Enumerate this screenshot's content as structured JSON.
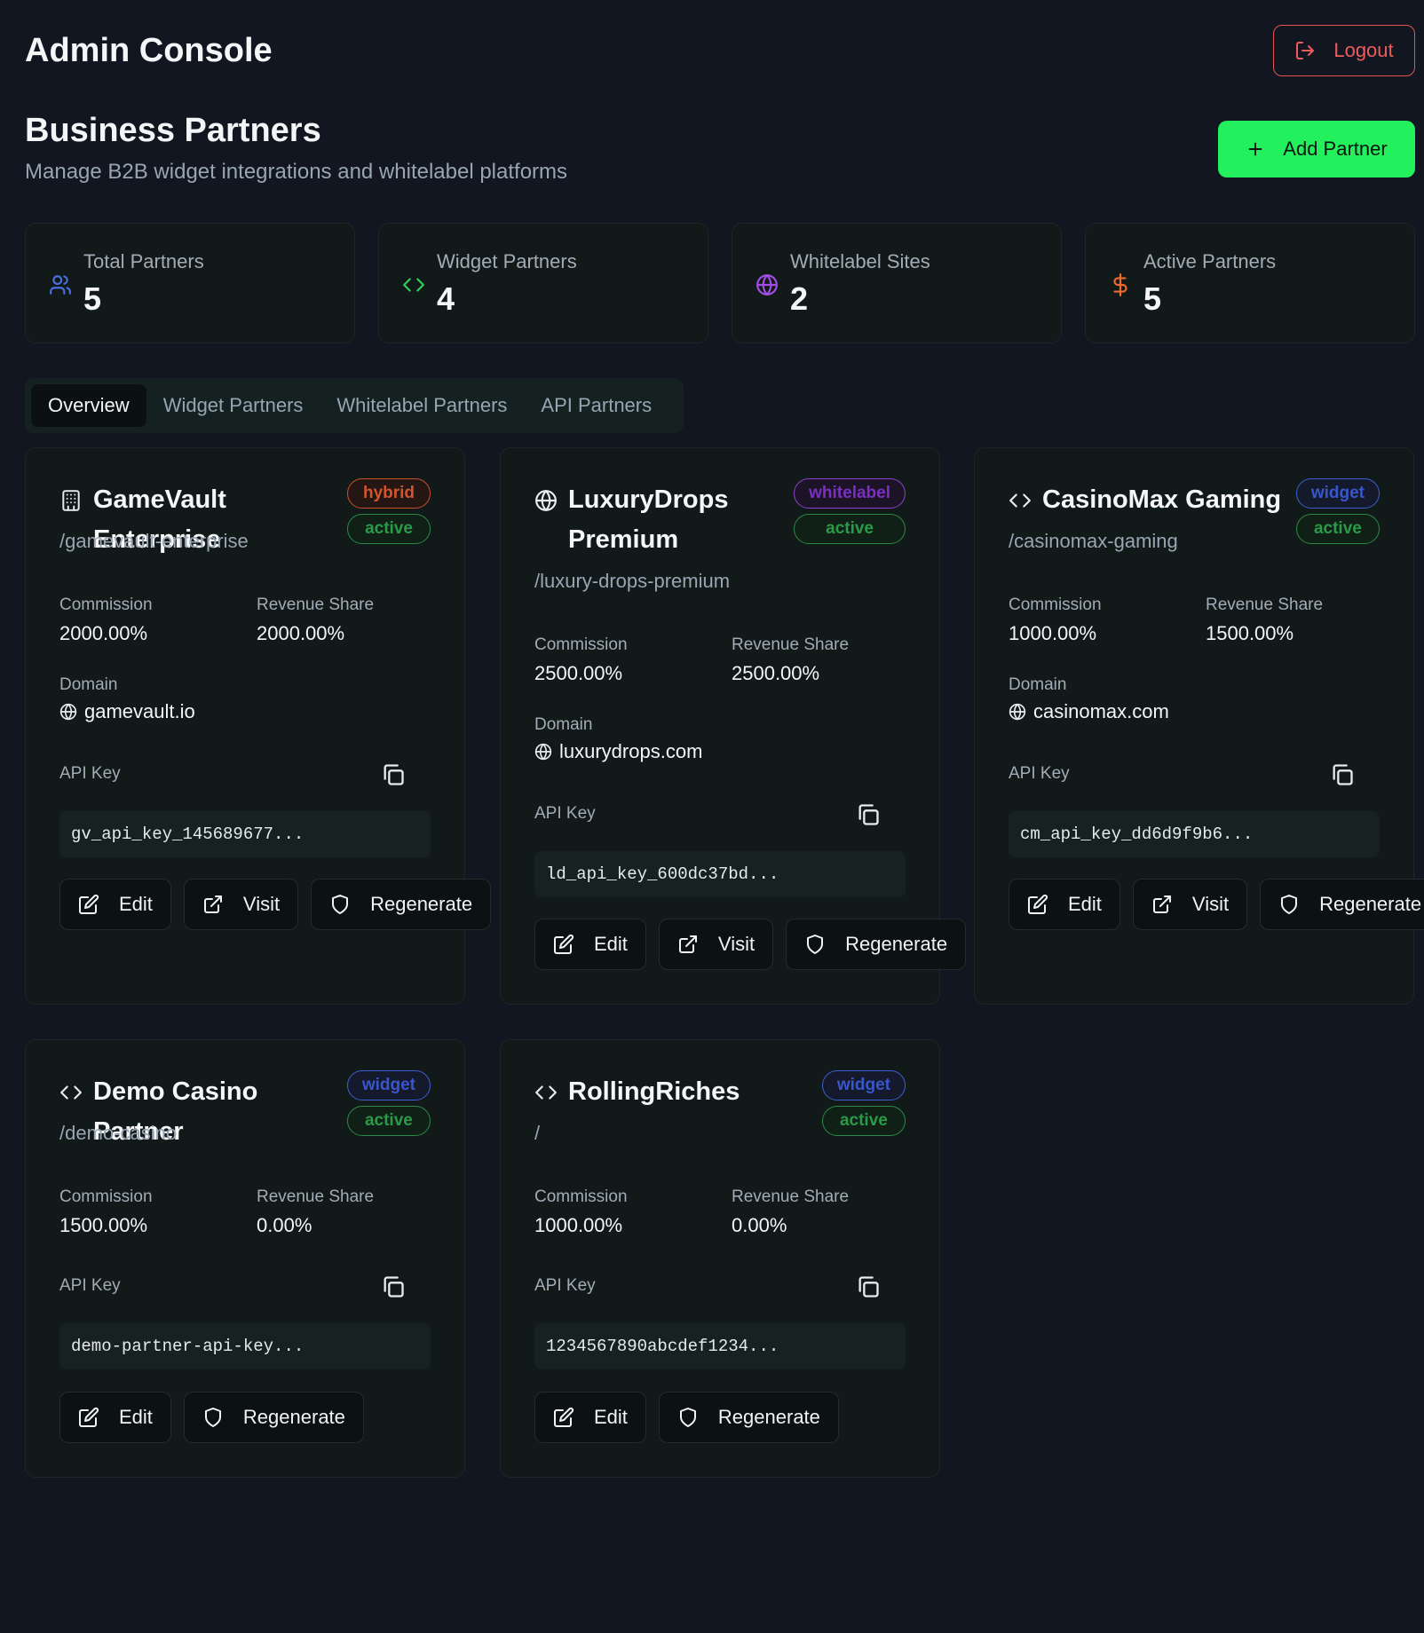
{
  "header": {
    "title": "Admin Console",
    "logout_label": "Logout"
  },
  "page": {
    "title": "Business Partners",
    "subtitle": "Manage B2B widget integrations and whitelabel platforms",
    "add_label": "Add Partner"
  },
  "stats": [
    {
      "label": "Total Partners",
      "value": "5",
      "icon": "users-icon",
      "color": "#4a6fe0"
    },
    {
      "label": "Widget Partners",
      "value": "4",
      "icon": "code-icon",
      "color": "#2fcf5a"
    },
    {
      "label": "Whitelabel Sites",
      "value": "2",
      "icon": "globe-icon",
      "color": "#a24ee6"
    },
    {
      "label": "Active Partners",
      "value": "5",
      "icon": "dollar-icon",
      "color": "#ef6a2c"
    }
  ],
  "tabs": [
    "Overview",
    "Widget Partners",
    "Whitelabel Partners",
    "API Partners"
  ],
  "labels": {
    "commission": "Commission",
    "revenue_share": "Revenue Share",
    "domain": "Domain",
    "api_key": "API Key",
    "edit": "Edit",
    "visit": "Visit",
    "regenerate": "Regenerate"
  },
  "partners": [
    {
      "name": "GameVault Enterprise",
      "slug": "/gamevault-enterprise",
      "type": "hybrid",
      "status": "active",
      "commission": "2000.00%",
      "revenue_share": "2000.00%",
      "domain": "gamevault.io",
      "api_key": "gv_api_key_145689677..."
    },
    {
      "name": "LuxuryDrops Premium",
      "slug": "/luxury-drops-premium",
      "type": "whitelabel",
      "status": "active",
      "commission": "2500.00%",
      "revenue_share": "2500.00%",
      "domain": "luxurydrops.com",
      "api_key": "ld_api_key_600dc37bd..."
    },
    {
      "name": "CasinoMax Gaming",
      "slug": "/casinomax-gaming",
      "type": "widget",
      "status": "active",
      "commission": "1000.00%",
      "revenue_share": "1500.00%",
      "domain": "casinomax.com",
      "api_key": "cm_api_key_dd6d9f9b6..."
    },
    {
      "name": "Demo Casino Partner",
      "slug": "/demo-casino",
      "type": "widget",
      "status": "active",
      "commission": "1500.00%",
      "revenue_share": "0.00%",
      "api_key": "demo-partner-api-key..."
    },
    {
      "name": "RollingRiches",
      "slug": "/",
      "type": "widget",
      "status": "active",
      "commission": "1000.00%",
      "revenue_share": "0.00%",
      "api_key": "1234567890abcdef1234..."
    }
  ]
}
